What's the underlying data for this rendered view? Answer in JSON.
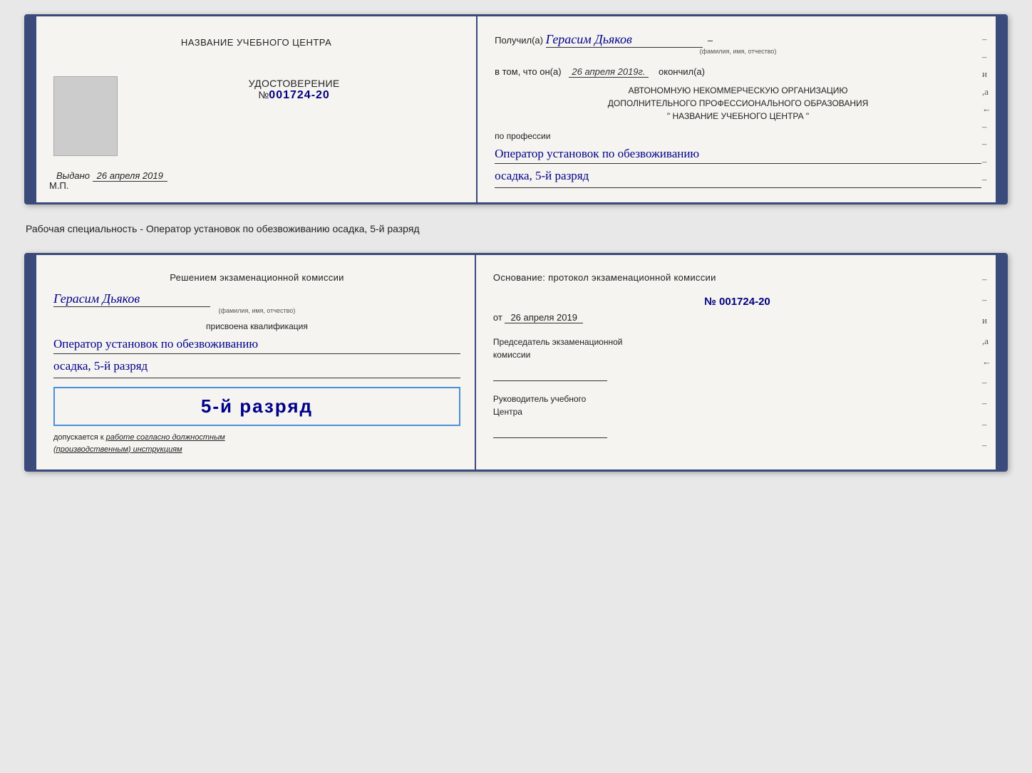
{
  "doc1": {
    "left": {
      "school_name": "НАЗВАНИЕ УЧЕБНОГО ЦЕНТРА",
      "cert_title": "УДОСТОВЕРЕНИЕ",
      "cert_number_label": "№",
      "cert_number": "001724-20",
      "issued_label": "Выдано",
      "issued_date": "26 апреля 2019",
      "mp_label": "М.П."
    },
    "right": {
      "received_prefix": "Получил(а)",
      "recipient_name": "Герасим Дьяков",
      "fio_label": "(фамилия, имя, отчество)",
      "confirmed_text": "в том, что он(а)",
      "confirmed_date": "26 апреля 2019г.",
      "completed_label": "окончил(а)",
      "org_line1": "АВТОНОМНУЮ НЕКОММЕРЧЕСКУЮ ОРГАНИЗАЦИЮ",
      "org_line2": "ДОПОЛНИТЕЛЬНОГО ПРОФЕССИОНАЛЬНОГО ОБРАЗОВАНИЯ",
      "org_line3": "\"  НАЗВАНИЕ УЧЕБНОГО ЦЕНТРА  \"",
      "profession_label": "по профессии",
      "profession_line1": "Оператор установок по обезвоживанию",
      "profession_line2": "осадка, 5-й разряд"
    }
  },
  "specialty_text": "Рабочая специальность - Оператор установок по обезвоживанию осадка, 5-й разряд",
  "doc2": {
    "left": {
      "commission_text": "Решением экзаменационной комиссии",
      "recipient_name": "Герасим Дьяков",
      "fio_label": "(фамилия, имя, отчество)",
      "assigned_label": "присвоена квалификация",
      "qualification_line1": "Оператор установок по обезвоживанию",
      "qualification_line2": "осадка, 5-й разряд",
      "rank_big": "5-й разряд",
      "допускается_prefix": "допускается к",
      "допускается_underline": "работе согласно должностным",
      "допускается_suffix": "(производственным) инструкциям"
    },
    "right": {
      "osnov_text": "Основание: протокол экзаменационной комиссии",
      "protocol_number": "№  001724-20",
      "date_prefix": "от",
      "date": "26 апреля 2019",
      "chairman_label_line1": "Председатель экзаменационной",
      "chairman_label_line2": "комиссии",
      "director_label_line1": "Руководитель учебного",
      "director_label_line2": "Центра"
    }
  }
}
